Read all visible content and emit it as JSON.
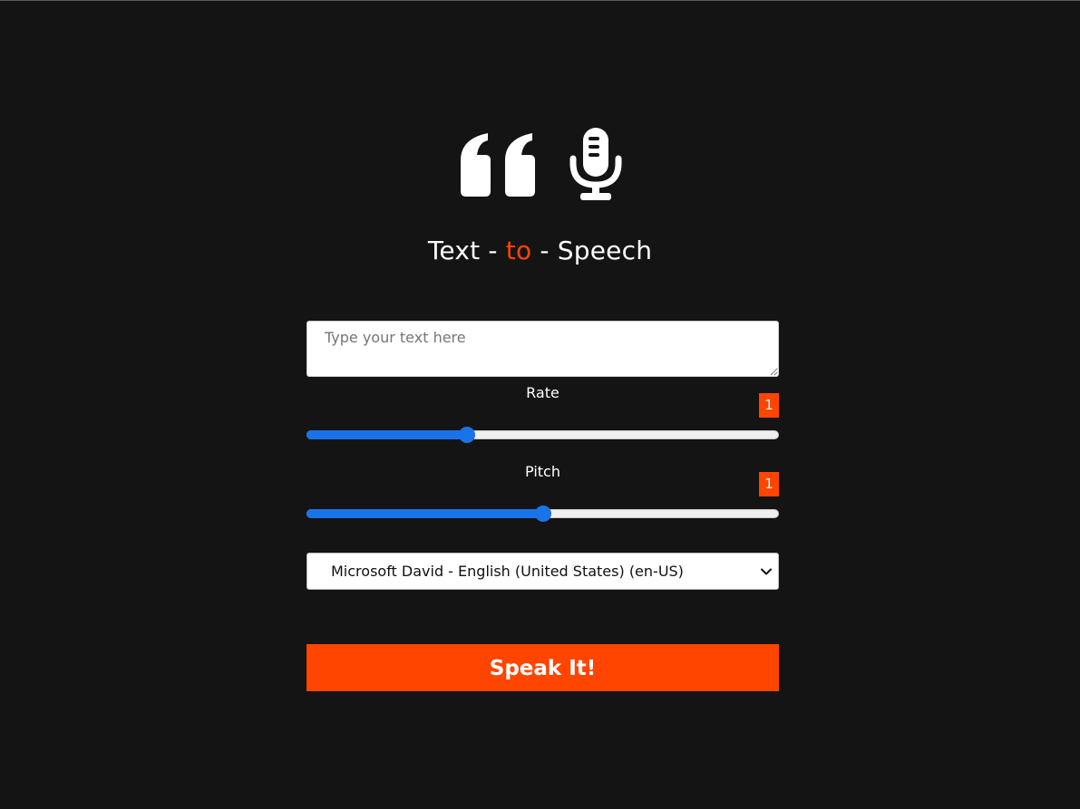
{
  "hero": {
    "icons": [
      "quote-left-icon",
      "microphone-icon"
    ]
  },
  "title": {
    "part1": "Text - ",
    "accent": "to",
    "part2": " - Speech"
  },
  "text_input": {
    "placeholder": "Type your text here",
    "value": ""
  },
  "rate": {
    "label": "Rate",
    "value_display": "1",
    "level_fraction": 0.34
  },
  "pitch": {
    "label": "Pitch",
    "value_display": "1",
    "level_fraction": 0.5
  },
  "voice_select": {
    "selected": "Microsoft David - English (United States) (en-US)"
  },
  "speak_button": {
    "label": "Speak It!"
  },
  "colors": {
    "background": "#141414",
    "accent": "#ff4500",
    "slider": "#1a73e8"
  }
}
